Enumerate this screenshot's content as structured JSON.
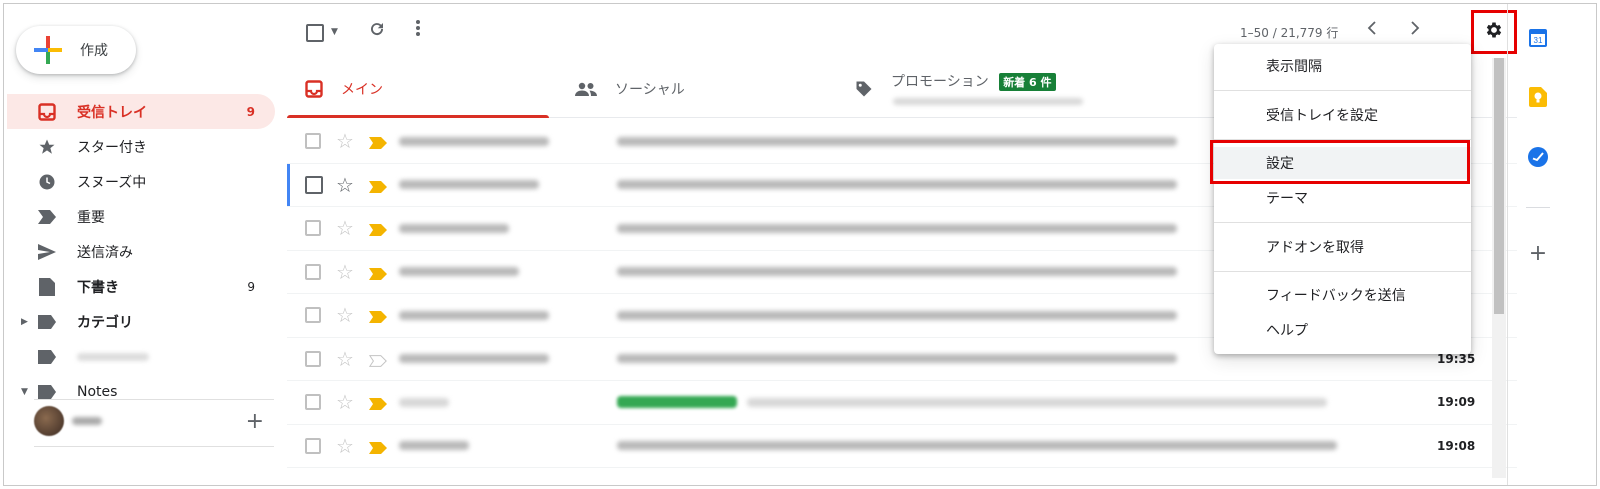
{
  "compose": {
    "label": "作成"
  },
  "sidebar": {
    "items": [
      {
        "label": "受信トレイ",
        "count": "9",
        "icon": "inbox-icon"
      },
      {
        "label": "スター付き",
        "count": "",
        "icon": "star-icon"
      },
      {
        "label": "スヌーズ中",
        "count": "",
        "icon": "clock-icon"
      },
      {
        "label": "重要",
        "count": "",
        "icon": "important-icon"
      },
      {
        "label": "送信済み",
        "count": "",
        "icon": "send-icon"
      },
      {
        "label": "下書き",
        "count": "9",
        "icon": "draft-icon"
      },
      {
        "label": "カテゴリ",
        "count": "",
        "icon": "label-icon"
      },
      {
        "label": "",
        "count": "",
        "icon": "label-icon"
      },
      {
        "label": "Notes",
        "count": "",
        "icon": "label-icon"
      }
    ]
  },
  "toolbar": {
    "pager_text": "1–50 / 21,779 行"
  },
  "tabs": {
    "main": "メイン",
    "social": "ソーシャル",
    "promo": "プロモーション",
    "promo_badge": "新着 6 件"
  },
  "mail_rows": [
    {
      "time": ""
    },
    {
      "time": ""
    },
    {
      "time": ""
    },
    {
      "time": ""
    },
    {
      "time": ""
    },
    {
      "time": "19:35"
    },
    {
      "time": "19:09"
    },
    {
      "time": "19:08"
    }
  ],
  "settings_menu": {
    "items": [
      "表示間隔",
      "受信トレイを設定",
      "設定",
      "テーマ",
      "アドオンを取得",
      "フィードバックを送信",
      "ヘルプ"
    ]
  },
  "colors": {
    "accent_red": "#d93025",
    "highlight_red": "#e60000",
    "badge_green": "#188038"
  }
}
